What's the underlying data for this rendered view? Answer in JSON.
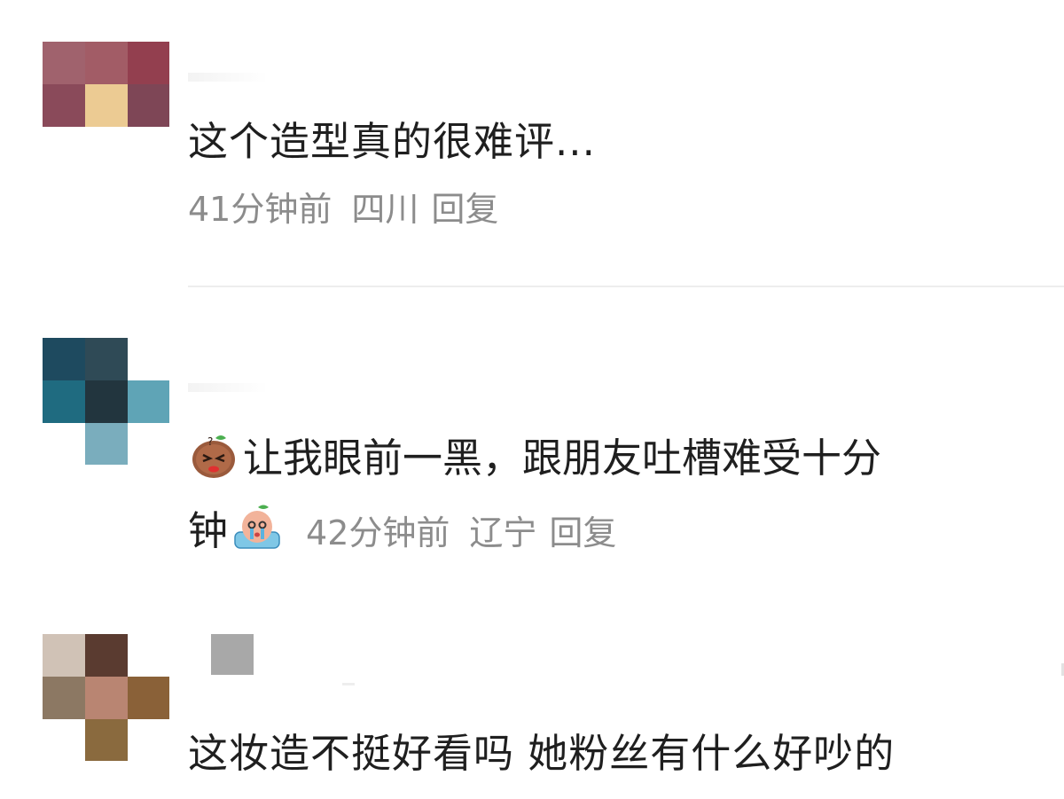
{
  "comments": [
    {
      "text": "这个造型真的很难评...",
      "time": "41分钟前",
      "location": "四川",
      "reply_label": "回复"
    },
    {
      "text_part1": "让我眼前一黑，跟朋友吐槽难受十分",
      "text_part2": "钟",
      "time": "42分钟前",
      "location": "辽宁",
      "reply_label": "回复",
      "emoji_1": "angry-sweet-potato-emoji",
      "emoji_2": "crying-sweet-potato-emoji"
    },
    {
      "text": "这妆造不挺好看吗 她粉丝有什么好吵的"
    }
  ],
  "colors": {
    "text": "#1f1f1f",
    "meta": "#8c8c8c",
    "divider": "#ededed"
  }
}
